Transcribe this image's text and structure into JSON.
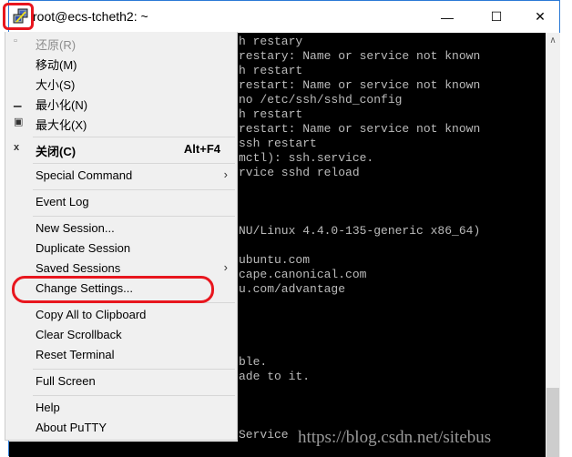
{
  "window": {
    "title": "root@ecs-tcheth2: ~",
    "controls": {
      "minimize": "—",
      "maximize": "☐",
      "close": "✕"
    }
  },
  "menu": {
    "items": [
      {
        "label": "还原(R)",
        "icon": "restore-icon",
        "disabled": true
      },
      {
        "label": "移动(M)"
      },
      {
        "label": "大小(S)"
      },
      {
        "label": "最小化(N)",
        "icon": "minimize-icon"
      },
      {
        "label": "最大化(X)",
        "icon": "maximize-icon"
      },
      {
        "label": "关闭(C)",
        "icon": "close-icon",
        "shortcut": "Alt+F4",
        "bold": true
      },
      {
        "label": "Special Command",
        "submenu": true
      },
      {
        "label": "Event Log"
      },
      {
        "label": "New Session..."
      },
      {
        "label": "Duplicate Session"
      },
      {
        "label": "Saved Sessions",
        "submenu": true
      },
      {
        "label": "Change Settings...",
        "highlighted_annotation": true
      },
      {
        "label": "Copy All to Clipboard"
      },
      {
        "label": "Clear Scrollback"
      },
      {
        "label": "Reset Terminal"
      },
      {
        "label": "Full Screen"
      },
      {
        "label": "Help"
      },
      {
        "label": "About PuTTY"
      }
    ]
  },
  "terminal": {
    "lines": [
      "h restary",
      "restary: Name or service not known",
      "h restart",
      "restart: Name or service not known",
      "no /etc/ssh/sshd_config",
      "h restart",
      "restart: Name or service not known",
      "ssh restart",
      "mctl): ssh.service.",
      "rvice sshd reload",
      "",
      "",
      "",
      "NU/Linux 4.4.0-135-generic x86_64)",
      "",
      "ubuntu.com",
      "cape.canonical.com",
      "u.com/advantage",
      "",
      "",
      "",
      "",
      "ble.",
      "ade to it.",
      "",
      "",
      "",
      "Service"
    ]
  },
  "watermark": "https://blog.csdn.net/sitebus",
  "colors": {
    "annotation": "#e8161e",
    "terminal_bg": "#000000",
    "terminal_fg": "#bbbbbb",
    "menu_bg": "#f0f0f0"
  }
}
